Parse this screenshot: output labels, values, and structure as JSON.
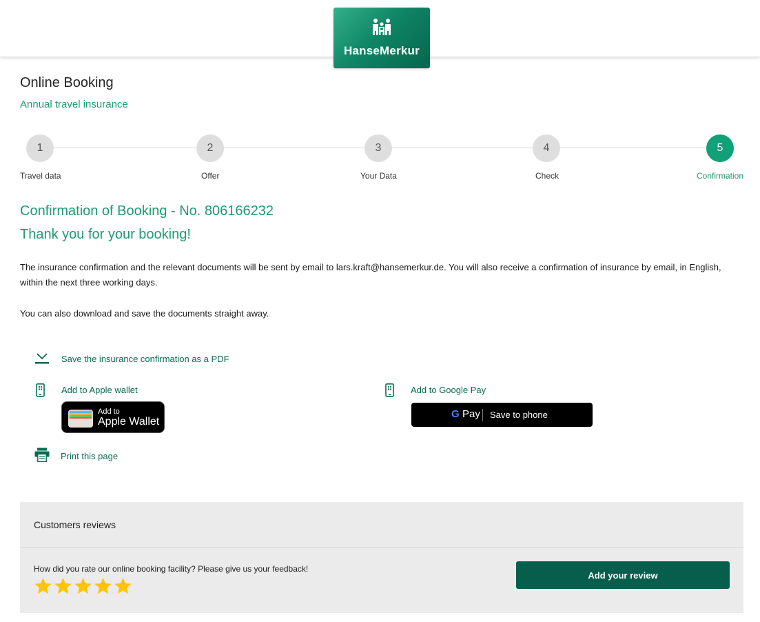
{
  "brand": {
    "name": "HanseMerkur"
  },
  "page": {
    "title": "Online Booking",
    "subtitle": "Annual travel insurance"
  },
  "steps": [
    {
      "number": "1",
      "label": "Travel data",
      "active": false
    },
    {
      "number": "2",
      "label": "Offer",
      "active": false
    },
    {
      "number": "3",
      "label": "Your Data",
      "active": false
    },
    {
      "number": "4",
      "label": "Check",
      "active": false
    },
    {
      "number": "5",
      "label": "Confirmation",
      "active": true
    }
  ],
  "confirmation": {
    "heading": "Confirmation of Booking - No. 806166232",
    "thanks": "Thank you for your booking!",
    "paragraph1": "The insurance confirmation and the relevant documents will be sent by email to lars.kraft@hansemerkur.de. You will also receive a confirmation of insurance by email, in English, within the next three working days.",
    "paragraph2": "You can also download and save the documents straight away."
  },
  "actions": {
    "save_pdf": {
      "label": "Save the insurance confirmation as a PDF",
      "icon": "download-icon"
    },
    "apple_wallet": {
      "label": "Add to Apple wallet",
      "icon": "phone-icon",
      "button_line1": "Add to",
      "button_line2": "Apple Wallet"
    },
    "google_pay": {
      "label": "Add to Google Pay",
      "icon": "phone-icon",
      "button_g": "G",
      "button_pay": "Pay",
      "button_save": "Save to phone"
    },
    "print": {
      "label": "Print this page",
      "icon": "printer-icon"
    }
  },
  "reviews": {
    "title": "Customers reviews",
    "question": "How did you rate our online booking facility? Please give us your feedback!",
    "rating": 5,
    "max_rating": 5,
    "button_label": "Add your review"
  },
  "colors": {
    "accent": "#1f9a72",
    "active_step": "#11a077",
    "button_dark": "#075e4c",
    "star": "#ffc400"
  }
}
